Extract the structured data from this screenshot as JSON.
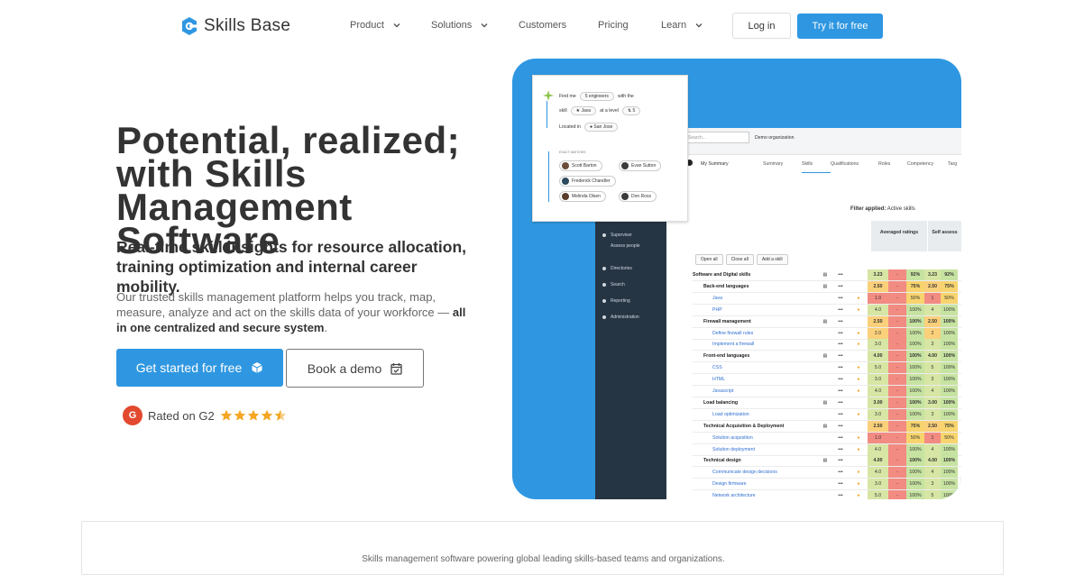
{
  "nav": {
    "brand": "Skills Base",
    "items": [
      {
        "label": "Product",
        "dropdown": true
      },
      {
        "label": "Solutions",
        "dropdown": true
      },
      {
        "label": "Customers",
        "dropdown": false
      },
      {
        "label": "Pricing",
        "dropdown": false
      },
      {
        "label": "Learn",
        "dropdown": true
      }
    ],
    "login": "Log in",
    "try": "Try it for free"
  },
  "hero": {
    "title": "Potential, realized; with Skills Management Software",
    "subtitle": "Real-time skill insights for resource allocation, training optimization and internal career mobility.",
    "desc_plain": "Our trusted skills management platform helps you track, map, measure, analyze and act on the skills data of your workforce — ",
    "desc_bold": "all in one centralized and secure system",
    "desc_end": ".",
    "cta_primary": "Get started for free",
    "cta_secondary": "Book a demo",
    "rating_label": "Rated on G2",
    "rating_badge": "G",
    "rating_stars": 4.5
  },
  "screenshot": {
    "finder": {
      "find_me": "Find me",
      "count": "5 engineers",
      "with_the": "with the",
      "skill_word": "skill",
      "skill": "Java",
      "at_level": "at a level",
      "level": "5",
      "located_in": "Located in",
      "location": "San Jose",
      "matches_label": "EXACT MATCHES",
      "matches": [
        "Scott Barton",
        "Evan Sutton",
        "Frederick Chandler",
        "Melinda Olsen",
        "Don Ross"
      ]
    },
    "search_placeholder": "Search...",
    "org": "Demo organization",
    "user": "My Summary",
    "tabs": [
      "Summary",
      "Skills",
      "Qualifications",
      "Roles",
      "Competency",
      "Targ"
    ],
    "filter_label": "Filter applied:",
    "filter_value": "Active skills",
    "col_avg": "Averaged ratings",
    "col_self": "Self assess",
    "toolbar": [
      "Open all",
      "Close all",
      "Add a skill"
    ],
    "sidebar": [
      "Supervisor",
      "Assess people",
      "Directories",
      "Search",
      "Reporting",
      "Administration"
    ],
    "rows": [
      {
        "name": "Software and Digital skills",
        "level": 0,
        "a": "3.23",
        "b": "-",
        "c": "92%",
        "d": "3.23",
        "e": "92%"
      },
      {
        "name": "Back-end languages",
        "level": 1,
        "a": "2.50",
        "b": "-",
        "c": "75%",
        "d": "2.50",
        "e": "75%"
      },
      {
        "name": "Java",
        "level": 2,
        "a": "1.0",
        "b": "-",
        "c": "50%",
        "d": "1",
        "e": "50%"
      },
      {
        "name": "PHP",
        "level": 2,
        "a": "4.0",
        "b": "-",
        "c": "100%",
        "d": "4",
        "e": "100%"
      },
      {
        "name": "Firewall management",
        "level": 1,
        "a": "2.50",
        "b": "-",
        "c": "100%",
        "d": "2.50",
        "e": "100%"
      },
      {
        "name": "Define firewall rules",
        "level": 2,
        "a": "2.0",
        "b": "-",
        "c": "100%",
        "d": "2",
        "e": "100%"
      },
      {
        "name": "Implement a firewall",
        "level": 2,
        "a": "3.0",
        "b": "-",
        "c": "100%",
        "d": "3",
        "e": "100%"
      },
      {
        "name": "Front-end languages",
        "level": 1,
        "a": "4.00",
        "b": "-",
        "c": "100%",
        "d": "4.00",
        "e": "100%"
      },
      {
        "name": "CSS",
        "level": 2,
        "a": "5.0",
        "b": "-",
        "c": "100%",
        "d": "5",
        "e": "100%"
      },
      {
        "name": "HTML",
        "level": 2,
        "a": "3.0",
        "b": "-",
        "c": "100%",
        "d": "3",
        "e": "100%"
      },
      {
        "name": "Javascript",
        "level": 2,
        "a": "4.0",
        "b": "-",
        "c": "100%",
        "d": "4",
        "e": "100%"
      },
      {
        "name": "Load balancing",
        "level": 1,
        "a": "3.00",
        "b": "-",
        "c": "100%",
        "d": "3.00",
        "e": "100%"
      },
      {
        "name": "Load optimization",
        "level": 2,
        "a": "3.0",
        "b": "-",
        "c": "100%",
        "d": "3",
        "e": "100%"
      },
      {
        "name": "Technical Acquisition & Deployment",
        "level": 1,
        "a": "2.50",
        "b": "-",
        "c": "75%",
        "d": "2.50",
        "e": "75%"
      },
      {
        "name": "Solution acquisition",
        "level": 2,
        "a": "1.0",
        "b": "-",
        "c": "50%",
        "d": "1",
        "e": "50%"
      },
      {
        "name": "Solution deployment",
        "level": 2,
        "a": "4.0",
        "b": "-",
        "c": "100%",
        "d": "4",
        "e": "100%"
      },
      {
        "name": "Technical design",
        "level": 1,
        "a": "4.00",
        "b": "-",
        "c": "100%",
        "d": "4.00",
        "e": "100%"
      },
      {
        "name": "Communicate design decisions",
        "level": 2,
        "a": "4.0",
        "b": "-",
        "c": "100%",
        "d": "4",
        "e": "100%"
      },
      {
        "name": "Design firmware",
        "level": 2,
        "a": "3.0",
        "b": "-",
        "c": "100%",
        "d": "3",
        "e": "100%"
      },
      {
        "name": "Network architecture",
        "level": 2,
        "a": "5.0",
        "b": "-",
        "c": "100%",
        "d": "5",
        "e": "100%"
      }
    ]
  },
  "footer": {
    "text": "Skills management software powering global leading skills-based teams and organizations."
  },
  "colors": {
    "brand_blue": "#2f97e1",
    "dark_text": "#333333",
    "g2_red": "#e2492f",
    "star": "#f5a623",
    "sidebar": "#263544"
  }
}
